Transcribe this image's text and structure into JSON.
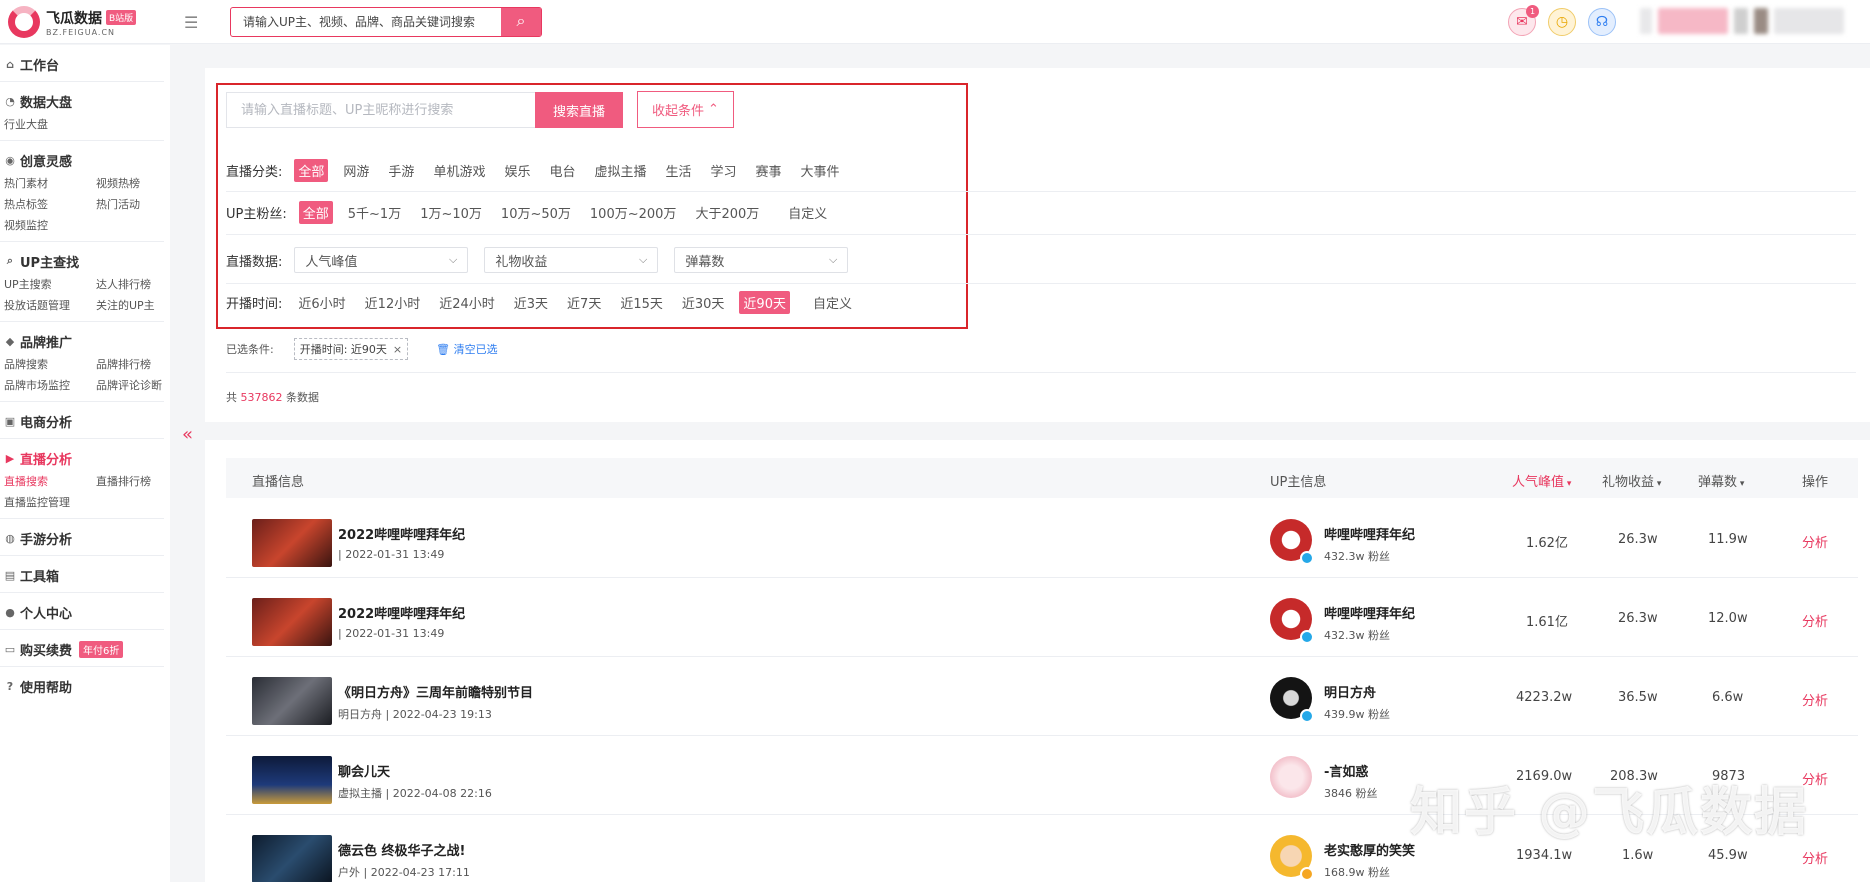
{
  "brand": {
    "name": "飞瓜数据",
    "badge": "B站版",
    "domain": "BZ.FEIGUA.CN"
  },
  "top_search": {
    "placeholder": "请输入UP主、视频、品牌、商品关键词搜索"
  },
  "notifications": {
    "mail_count": "1"
  },
  "sidebar": {
    "workbench": "工作台",
    "dashboard": {
      "title": "数据大盘",
      "items": [
        "行业大盘"
      ]
    },
    "creative": {
      "title": "创意灵感",
      "items": [
        "热门素材",
        "视频热榜",
        "热点标签",
        "热门活动",
        "视频监控"
      ]
    },
    "up_search": {
      "title": "UP主查找",
      "items": [
        "UP主搜索",
        "达人排行榜",
        "投放话题管理",
        "关注的UP主"
      ]
    },
    "brand": {
      "title": "品牌推广",
      "items": [
        "品牌搜索",
        "品牌排行榜",
        "品牌市场监控",
        "品牌评论诊断"
      ]
    },
    "ecommerce": "电商分析",
    "live": {
      "title": "直播分析",
      "items": [
        "直播搜索",
        "直播排行榜",
        "直播监控管理"
      ]
    },
    "mobile_game": "手游分析",
    "toolbox": "工具箱",
    "personal": "个人中心",
    "purchase": {
      "title": "购买续费",
      "promo": "年付6折"
    },
    "help": "使用帮助"
  },
  "filters": {
    "search_placeholder": "请输入直播标题、UP主昵称进行搜索",
    "search_button": "搜索直播",
    "fold_button": "收起条件",
    "category": {
      "label": "直播分类:",
      "options": [
        "全部",
        "网游",
        "手游",
        "单机游戏",
        "娱乐",
        "电台",
        "虚拟主播",
        "生活",
        "学习",
        "赛事",
        "大事件"
      ],
      "selected": "全部"
    },
    "fans": {
      "label": "UP主粉丝:",
      "options": [
        "全部",
        "5千~1万",
        "1万~10万",
        "10万~50万",
        "100万~200万",
        "大于200万",
        "自定义"
      ],
      "selected": "全部"
    },
    "data": {
      "label": "直播数据:",
      "selects": [
        "人气峰值",
        "礼物收益",
        "弹幕数"
      ]
    },
    "time": {
      "label": "开播时间:",
      "options": [
        "近6小时",
        "近12小时",
        "近24小时",
        "近3天",
        "近7天",
        "近15天",
        "近30天",
        "近90天",
        "自定义"
      ],
      "selected": "近90天"
    },
    "chosen_label": "已选条件:",
    "chosen_chip": "开播时间: 近90天",
    "clear": "清空已选",
    "total_prefix": "共",
    "total_count": "537862",
    "total_suffix": "条数据"
  },
  "table": {
    "headers": {
      "live_info": "直播信息",
      "up_info": "UP主信息",
      "peak": "人气峰值",
      "gift": "礼物收益",
      "danmaku": "弹幕数",
      "action": "操作"
    },
    "rows": [
      {
        "title": "2022哔哩哔哩拜年纪",
        "sub": "| 2022-01-31 13:49",
        "up": "哔哩哔哩拜年纪",
        "fans": "432.3w 粉丝",
        "peak": "1.62亿",
        "gift": "26.3w",
        "danmaku": "11.9w",
        "action": "分析"
      },
      {
        "title": "2022哔哩哔哩拜年纪",
        "sub": "| 2022-01-31 13:49",
        "up": "哔哩哔哩拜年纪",
        "fans": "432.3w 粉丝",
        "peak": "1.61亿",
        "gift": "26.3w",
        "danmaku": "12.0w",
        "action": "分析"
      },
      {
        "title": "《明日方舟》三周年前瞻特别节目",
        "sub": "明日方舟 | 2022-04-23 19:13",
        "up": "明日方舟",
        "fans": "439.9w 粉丝",
        "peak": "4223.2w",
        "gift": "36.5w",
        "danmaku": "6.6w",
        "action": "分析"
      },
      {
        "title": "聊会儿天",
        "sub": "虚拟主播 | 2022-04-08 22:16",
        "up": "-言如惑",
        "fans": "3846 粉丝",
        "peak": "2169.0w",
        "gift": "208.3w",
        "danmaku": "9873",
        "action": "分析"
      },
      {
        "title": "德云色 终极华子之战!",
        "sub": "户外 | 2022-04-23 17:11",
        "up": "老实憨厚的笑笑",
        "fans": "168.9w 粉丝",
        "peak": "1934.1w",
        "gift": "1.6w",
        "danmaku": "45.9w",
        "action": "分析"
      }
    ]
  },
  "watermark": "知乎 @飞瓜数据",
  "colors": {
    "accent": "#f05b7f",
    "highlight_border": "#d9252b",
    "link": "#2f7ef0"
  }
}
